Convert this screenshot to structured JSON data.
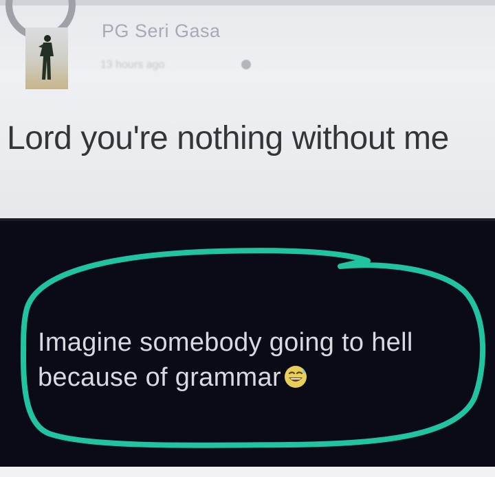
{
  "post": {
    "author": "PG Seri Gasa",
    "timestamp": "13 hours ago",
    "text": "Lord you're nothing without me"
  },
  "comment": {
    "text": "Imagine somebody going to hell because of grammar",
    "emoji": "grinning-sweat-emoji"
  },
  "colors": {
    "post_background": "#eceef1",
    "comment_background": "#0a0b17",
    "annotation_circle": "#20c4a0",
    "comment_text": "#d9dae0"
  }
}
